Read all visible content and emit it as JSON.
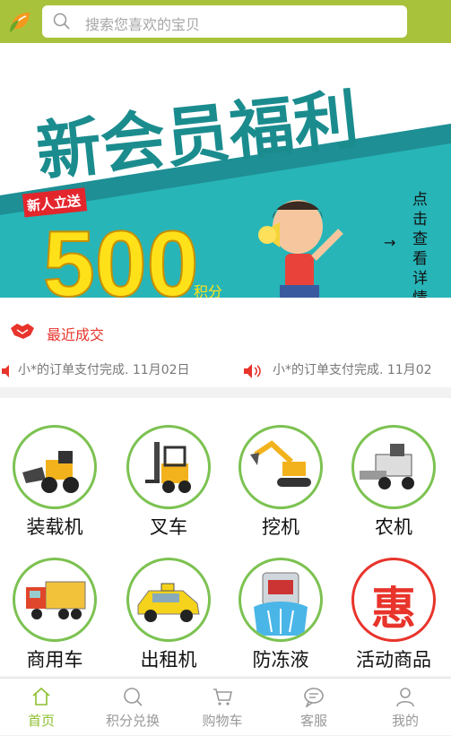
{
  "search": {
    "placeholder": "搜索您喜欢的宝贝"
  },
  "banner": {
    "headline": "新会员福利",
    "badge": "新人立送",
    "big_number": "500",
    "points_unit": "积分",
    "side_text": [
      "点",
      "击",
      "查",
      "看",
      "详",
      "情"
    ],
    "arrow": "→"
  },
  "recent": {
    "title": "最近成交",
    "deals": [
      {
        "text": "小*的订单支付完成. 11月02日"
      },
      {
        "text": "小*的订单支付完成. 11月02"
      }
    ]
  },
  "categories": [
    {
      "label": "装载机",
      "icon": "loader-icon"
    },
    {
      "label": "叉车",
      "icon": "forklift-icon"
    },
    {
      "label": "挖机",
      "icon": "excavator-icon"
    },
    {
      "label": "农机",
      "icon": "harvester-icon"
    },
    {
      "label": "商用车",
      "icon": "truck-icon"
    },
    {
      "label": "出租机",
      "icon": "taxi-icon"
    },
    {
      "label": "防冻液",
      "icon": "antifreeze-icon"
    },
    {
      "label": "活动商品",
      "icon": "promo-icon",
      "symbol": "惠"
    }
  ],
  "tabs": [
    {
      "label": "首页",
      "icon": "home-icon",
      "active": true
    },
    {
      "label": "积分兑换",
      "icon": "search-icon"
    },
    {
      "label": "购物车",
      "icon": "cart-icon"
    },
    {
      "label": "客服",
      "icon": "chat-icon"
    },
    {
      "label": "我的",
      "icon": "user-icon"
    }
  ],
  "colors": {
    "header": "#a9c23b",
    "accent_red": "#e8342b",
    "tab_active": "#8dbf2f"
  }
}
